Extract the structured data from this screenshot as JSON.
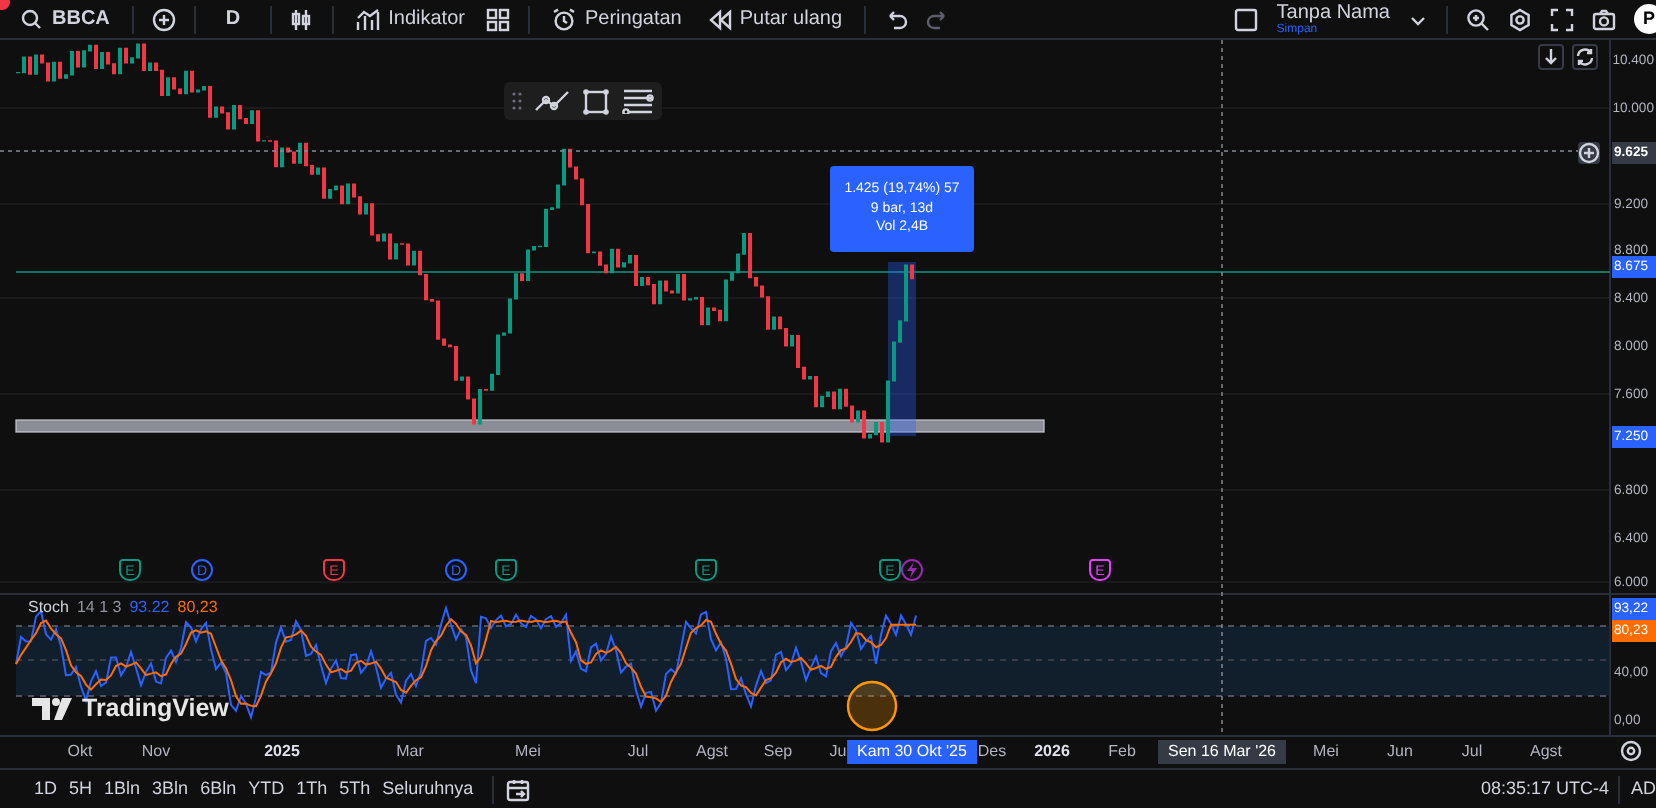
{
  "toolbar": {
    "symbol": "BBCA",
    "interval": "D",
    "indicators": "Indikator",
    "alerts": "Peringatan",
    "replay": "Putar ulang",
    "history": [
      {
        "kind": "undo",
        "disabled": false
      },
      {
        "kind": "redo",
        "disabled": true
      }
    ],
    "layout": {
      "name": "Tanpa Nama",
      "status": "Simpan"
    },
    "avatar": "P"
  },
  "measure": {
    "lines": [
      "1.425 (19,74%) 57",
      "9 bar, 13d",
      "Vol 2,4B"
    ]
  },
  "markers": [
    {
      "kind": "flag",
      "letter": "E",
      "color": "#089981"
    },
    {
      "kind": "circle",
      "letter": "D",
      "color": "#2962ff"
    },
    {
      "kind": "flag",
      "letter": "E",
      "color": "#f23645"
    },
    {
      "kind": "circle",
      "letter": "D",
      "color": "#2962ff"
    },
    {
      "kind": "flag",
      "letter": "E",
      "color": "#089981"
    },
    {
      "kind": "flag",
      "letter": "E",
      "color": "#089981"
    },
    {
      "kind": "flag",
      "letter": "E",
      "color": "#089981"
    },
    {
      "kind": "lightning",
      "color": "#9c27b0"
    },
    {
      "kind": "flag",
      "letter": "E",
      "color": "#e040fb"
    }
  ],
  "stoch": {
    "name": "Stoch",
    "params": "14 1 3",
    "k": "93.22",
    "d": "80,23"
  },
  "watermark": "TradingView",
  "price_axis": [
    {
      "label": "10.400",
      "kind": "tick"
    },
    {
      "label": "10.000",
      "kind": "tick"
    },
    {
      "label": "9.625",
      "kind": "crosshair"
    },
    {
      "label": "9.200",
      "kind": "tick"
    },
    {
      "label": "8.800",
      "kind": "tick"
    },
    {
      "label": "8.675",
      "kind": "highlight"
    },
    {
      "label": "8.400",
      "kind": "tick"
    },
    {
      "label": "8.000",
      "kind": "tick"
    },
    {
      "label": "7.600",
      "kind": "tick"
    },
    {
      "label": "7.250",
      "kind": "highlight"
    },
    {
      "label": "6.800",
      "kind": "tick"
    },
    {
      "label": "6.400",
      "kind": "tick"
    },
    {
      "label": "6.000",
      "kind": "tick"
    },
    {
      "label": "93,22",
      "kind": "highlight"
    },
    {
      "label": "80,23",
      "kind": "orange"
    },
    {
      "label": "40,00",
      "kind": "tick"
    },
    {
      "label": "0,00",
      "kind": "tick"
    }
  ],
  "time_axis": [
    {
      "label": "Okt",
      "kind": "month"
    },
    {
      "label": "Nov",
      "kind": "month"
    },
    {
      "label": "2025",
      "kind": "year"
    },
    {
      "label": "Mar",
      "kind": "month"
    },
    {
      "label": "Mei",
      "kind": "month"
    },
    {
      "label": "Jul",
      "kind": "month"
    },
    {
      "label": "Agst",
      "kind": "month"
    },
    {
      "label": "Sep",
      "kind": "month"
    },
    {
      "label": "Ju",
      "kind": "month"
    },
    {
      "label": "Kam 30 Okt '25",
      "kind": "cursor"
    },
    {
      "label": "Des",
      "kind": "month"
    },
    {
      "label": "2026",
      "kind": "year"
    },
    {
      "label": "Feb",
      "kind": "month"
    },
    {
      "label": "Sen 16 Mar '26",
      "kind": "crosshair"
    },
    {
      "label": "Mei",
      "kind": "month"
    },
    {
      "label": "Jun",
      "kind": "month"
    },
    {
      "label": "Jul",
      "kind": "month"
    },
    {
      "label": "Agst",
      "kind": "month"
    }
  ],
  "ranges": [
    "1D",
    "5H",
    "1Bln",
    "3Bln",
    "6Bln",
    "YTD",
    "1Th",
    "5Th",
    "Seluruhnya"
  ],
  "clock": "08:35:17 UTC-4",
  "corner": "AD"
}
